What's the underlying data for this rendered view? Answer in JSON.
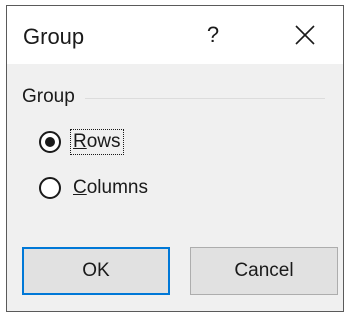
{
  "dialog": {
    "title": "Group",
    "help_label": "?",
    "group_label": "Group",
    "options": [
      {
        "label_underlined": "R",
        "label_rest": "ows",
        "checked": true
      },
      {
        "label_underlined": "C",
        "label_rest": "olumns",
        "checked": false
      }
    ],
    "ok_label": "OK",
    "cancel_label": "Cancel"
  },
  "icons": {
    "close": "close-icon",
    "radio_checked": "radio-checked-icon",
    "radio_unchecked": "radio-unchecked-icon"
  },
  "colors": {
    "dialog_bg": "#f0f0f0",
    "titlebar_bg": "#ffffff",
    "default_button_border": "#0078d7",
    "button_bg": "#e1e1e1"
  }
}
